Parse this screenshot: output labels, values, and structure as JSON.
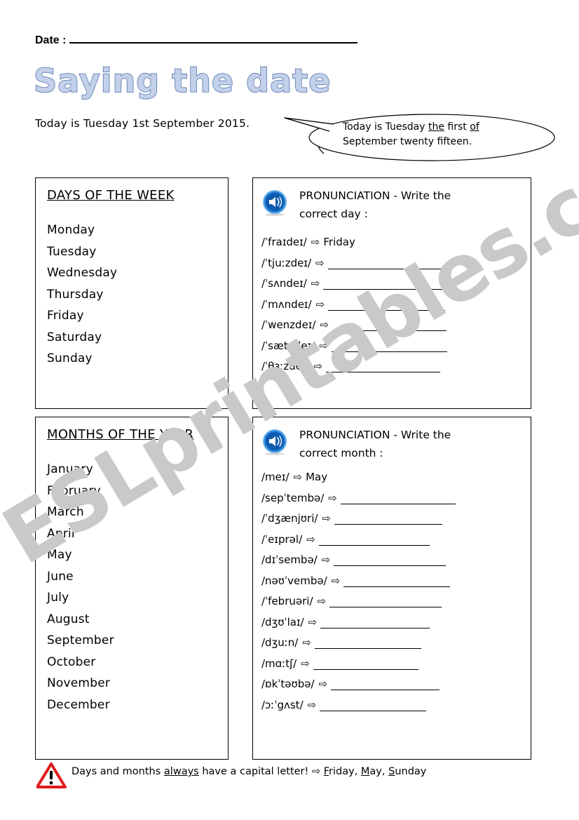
{
  "header": {
    "date_label": "Date :",
    "title": "Saying the date",
    "today_line": "Today is Tuesday 1st September 2015."
  },
  "speech_bubble": {
    "line1_prefix": "Today is Tuesday ",
    "line1_underline1": "the",
    "line1_mid": " first ",
    "line1_underline2": "of",
    "line2": "September twenty fifteen."
  },
  "days_panel": {
    "heading": "DAYS OF THE WEEK",
    "items": [
      "Monday",
      "Tuesday",
      "Wednesday",
      "Thursday",
      "Friday",
      "Saturday",
      "Sunday"
    ]
  },
  "months_panel": {
    "heading": "MONTHS OF THE YEAR",
    "items": [
      "January",
      "February",
      "March",
      "April",
      "May",
      "June",
      "July",
      "August",
      "September",
      "October",
      "November",
      "December"
    ]
  },
  "days_pronunciation": {
    "icon": "speaker-icon",
    "title": "PRONUNCIATION - Write the correct day :",
    "arrow_glyph": "⇨",
    "rows": [
      {
        "ipa": "/ˈfraɪdeɪ/",
        "answer": "Friday",
        "blank_width": 0
      },
      {
        "ipa": "/ˈtjuːzdeɪ/",
        "answer": "",
        "blank_width": 172
      },
      {
        "ipa": "/ˈsʌndeɪ/",
        "answer": "",
        "blank_width": 172
      },
      {
        "ipa": "/ˈmʌndeɪ/",
        "answer": "",
        "blank_width": 167
      },
      {
        "ipa": "/ˈwenzdeɪ/",
        "answer": "",
        "blank_width": 163
      },
      {
        "ipa": "/ˈsætədeɪ/",
        "answer": "",
        "blank_width": 165
      },
      {
        "ipa": "/ˈθɜːzdeɪ/",
        "answer": "",
        "blank_width": 163
      }
    ]
  },
  "months_pronunciation": {
    "icon": "speaker-icon",
    "title": "PRONUNCIATION - Write the correct month :",
    "arrow_glyph": "⇨",
    "rows": [
      {
        "ipa": "/meɪ/",
        "answer": "May",
        "blank_width": 0
      },
      {
        "ipa": "/sepˈtembə/",
        "answer": "",
        "blank_width": 164
      },
      {
        "ipa": "/ˈdʒænjʊri/",
        "answer": "",
        "blank_width": 154
      },
      {
        "ipa": "/ˈeɪprəl/",
        "answer": "",
        "blank_width": 158
      },
      {
        "ipa": "/dɪˈsembə/",
        "answer": "",
        "blank_width": 160
      },
      {
        "ipa": "/nəʊˈvembə/",
        "answer": "",
        "blank_width": 152
      },
      {
        "ipa": "/ˈfebruəri/",
        "answer": "",
        "blank_width": 160
      },
      {
        "ipa": "/dʒʊˈlaɪ/",
        "answer": "",
        "blank_width": 156
      },
      {
        "ipa": "/dʒuːn/",
        "answer": "",
        "blank_width": 152
      },
      {
        "ipa": "/mɑːtʃ/",
        "answer": "",
        "blank_width": 150
      },
      {
        "ipa": "/ɒkˈtəʊbə/",
        "answer": "",
        "blank_width": 155
      },
      {
        "ipa": "/ɔːˈgʌst/",
        "answer": "",
        "blank_width": 152
      }
    ]
  },
  "footer": {
    "icon": "warning-triangle-icon",
    "prefix": "Days and months ",
    "underlined": "always",
    "middle": " have a capital letter! ",
    "arrow_glyph": "⇨",
    "examples_prefix": " ",
    "example1_initial": "F",
    "example1_rest": "riday, ",
    "example2_initial": "M",
    "example2_rest": "ay, ",
    "example3_initial": "S",
    "example3_rest": "unday"
  },
  "watermark": {
    "text": "ESLprintables.com",
    "color": "#c9c9c9"
  },
  "colors": {
    "title_fill": "#c2d0e9",
    "title_outline": "#4d6ea8",
    "speaker_blue": "#1f63b5",
    "warning_red": "#e01b1b",
    "border": "#000000"
  }
}
